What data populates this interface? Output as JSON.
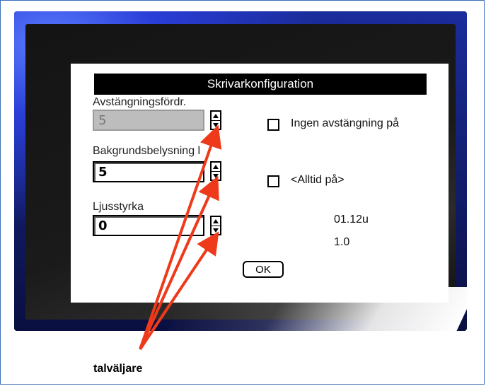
{
  "dialog": {
    "title": "Skrivarkonfiguration",
    "shutdown_delay": {
      "label": "Avstängningsfördr.",
      "value": "5"
    },
    "backlight": {
      "label": "Bakgrundsbelysning l",
      "value": "5"
    },
    "brightness": {
      "label": "Ljusstyrka",
      "value": "0"
    },
    "no_shutdown": {
      "label": "Ingen avstängning på",
      "checked": false
    },
    "always_on": {
      "label": "<Alltid på>",
      "checked": false
    },
    "version_1": "01.12u",
    "version_2": "1.0",
    "ok_label": "OK"
  },
  "annotation": {
    "caption": "talväljare",
    "arrow_color": "#ee3a1a"
  }
}
